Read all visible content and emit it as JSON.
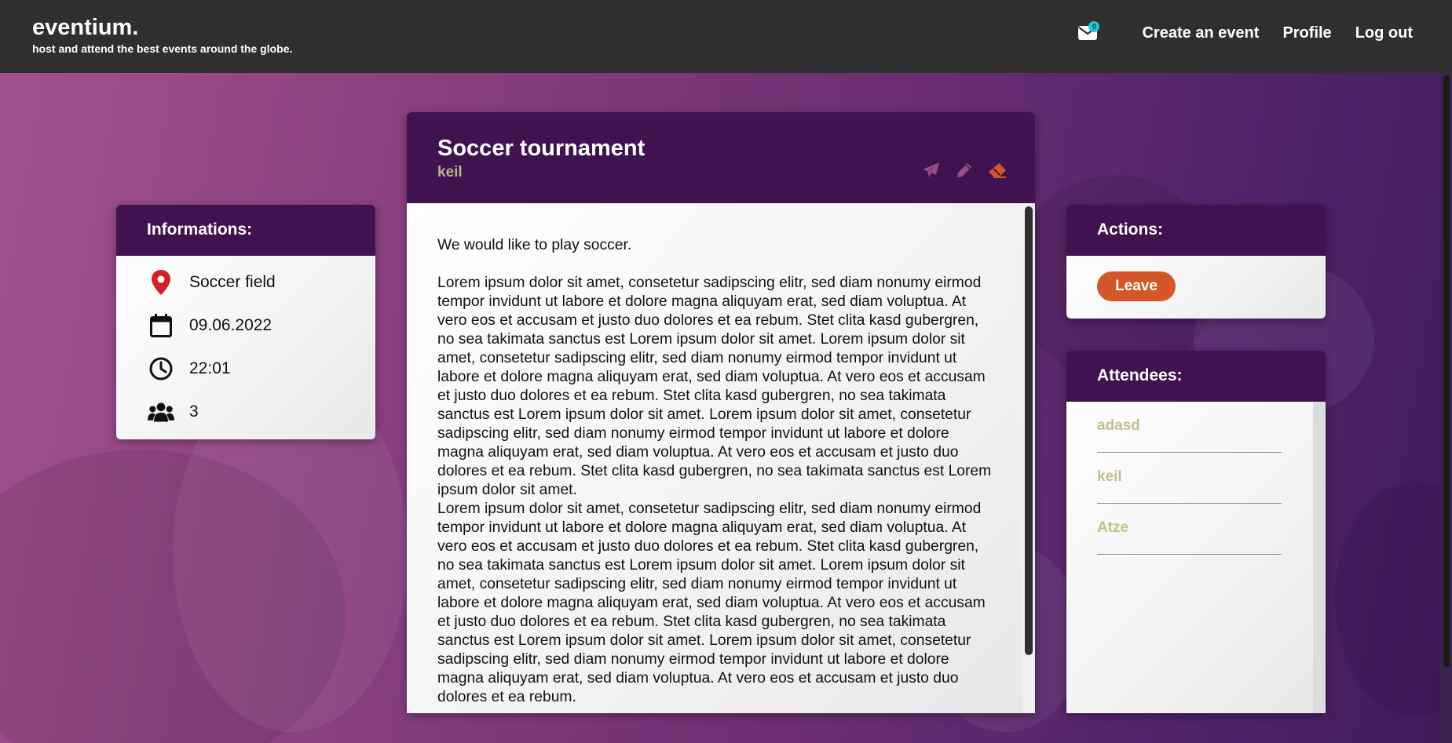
{
  "brand": {
    "name": "eventium.",
    "tagline": "host and attend the best events around the globe."
  },
  "nav": {
    "mail_count": "0",
    "create_event": "Create an event",
    "profile": "Profile",
    "logout": "Log out"
  },
  "info": {
    "title": "Informations:",
    "location": "Soccer field",
    "date": "09.06.2022",
    "time": "22:01",
    "attendee_count": "3"
  },
  "event": {
    "title": "Soccer tournament",
    "owner": "keil",
    "intro": "We would like to play soccer.",
    "paragraphs": [
      "Lorem ipsum dolor sit amet, consetetur sadipscing elitr, sed diam nonumy eirmod tempor invidunt ut labore et dolore magna aliquyam erat, sed diam voluptua. At vero eos et accusam et justo duo dolores et ea rebum. Stet clita kasd gubergren, no sea takimata sanctus est Lorem ipsum dolor sit amet. Lorem ipsum dolor sit amet, consetetur sadipscing elitr, sed diam nonumy eirmod tempor invidunt ut labore et dolore magna aliquyam erat, sed diam voluptua. At vero eos et accusam et justo duo dolores et ea rebum. Stet clita kasd gubergren, no sea takimata sanctus est Lorem ipsum dolor sit amet. Lorem ipsum dolor sit amet, consetetur sadipscing elitr, sed diam nonumy eirmod tempor invidunt ut labore et dolore magna aliquyam erat, sed diam voluptua. At vero eos et accusam et justo duo dolores et ea rebum. Stet clita kasd gubergren, no sea takimata sanctus est Lorem ipsum dolor sit amet.",
      "Lorem ipsum dolor sit amet, consetetur sadipscing elitr, sed diam nonumy eirmod tempor invidunt ut labore et dolore magna aliquyam erat, sed diam voluptua. At vero eos et accusam et justo duo dolores et ea rebum. Stet clita kasd gubergren, no sea takimata sanctus est Lorem ipsum dolor sit amet. Lorem ipsum dolor sit amet, consetetur sadipscing elitr, sed diam nonumy eirmod tempor invidunt ut labore et dolore magna aliquyam erat, sed diam voluptua. At vero eos et accusam et justo duo dolores et ea rebum. Stet clita kasd gubergren, no sea takimata sanctus est Lorem ipsum dolor sit amet. Lorem ipsum dolor sit amet, consetetur sadipscing elitr, sed diam nonumy eirmod tempor invidunt ut labore et dolore magna aliquyam erat, sed diam voluptua. At vero eos et accusam et justo duo dolores et ea rebum."
    ],
    "icons": [
      "paper-plane-icon",
      "pencil-icon",
      "eraser-icon"
    ]
  },
  "actions": {
    "title": "Actions:",
    "leave_label": "Leave"
  },
  "attendees": {
    "title": "Attendees:",
    "items": [
      "adasd",
      "keil",
      "Atze"
    ]
  },
  "colors": {
    "header_bg": "#40124f",
    "navbar_bg": "#2f2f2f",
    "accent_orange": "#d4572a",
    "owner_text": "#b7b78c",
    "attendee_text": "#c2c08a",
    "badge": "#1ec8d6"
  }
}
